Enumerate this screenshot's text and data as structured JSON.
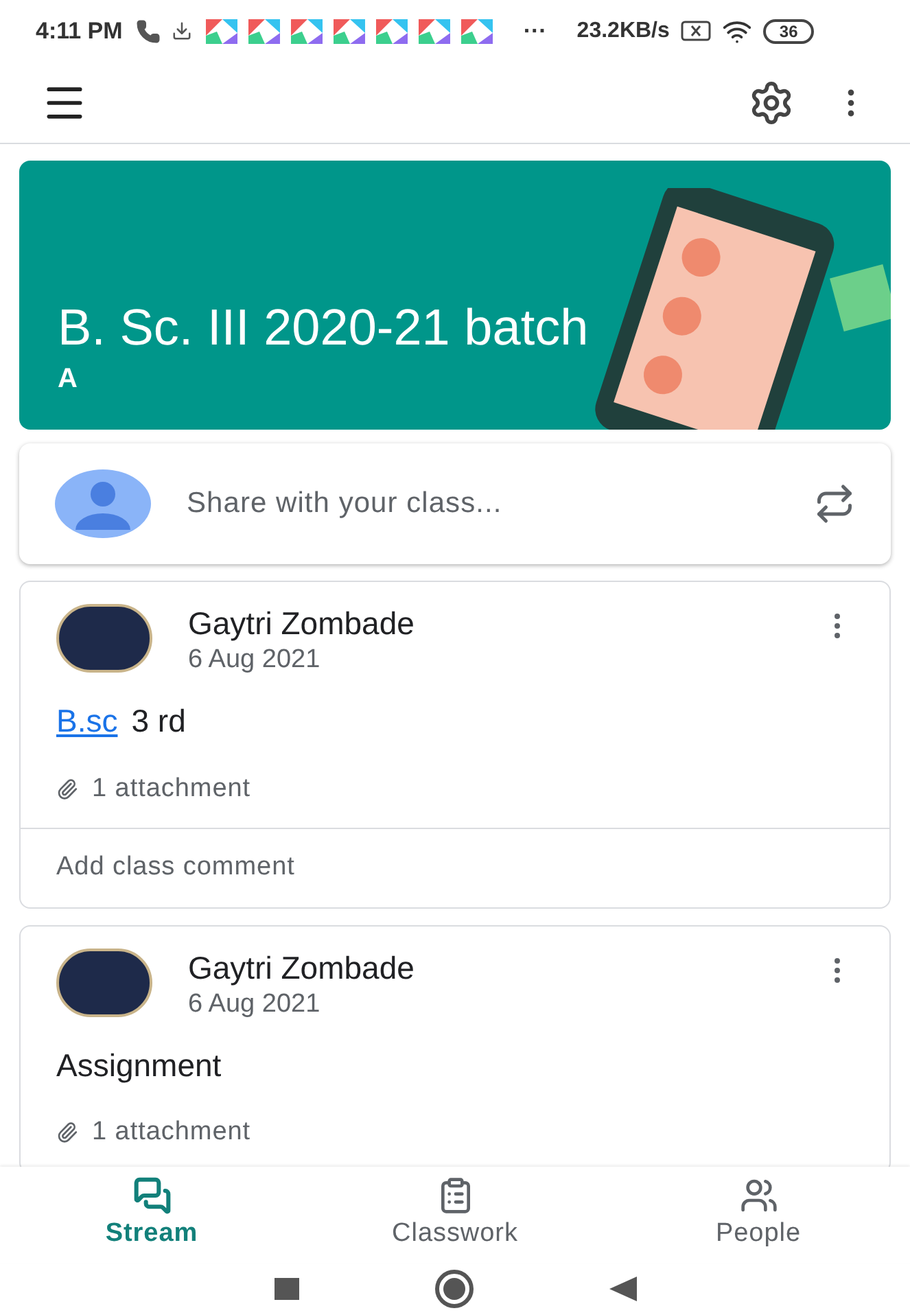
{
  "status_bar": {
    "time": "4:11 PM",
    "notifications": [
      {
        "kind": "app"
      },
      {
        "kind": "app"
      },
      {
        "kind": "app"
      },
      {
        "kind": "app"
      },
      {
        "kind": "app"
      },
      {
        "kind": "app"
      },
      {
        "kind": "app"
      }
    ],
    "more": "···",
    "speed": "23.2KB/s",
    "battery": "36"
  },
  "class": {
    "title": "B. Sc. III 2020-21 batch",
    "section": "A"
  },
  "share": {
    "placeholder": "Share with your class..."
  },
  "posts": [
    {
      "author": "Gaytri Zombade",
      "date": "6 Aug 2021",
      "body": [
        {
          "kind": "link",
          "text": "B.sc"
        },
        {
          "kind": "text",
          "text": "3 rd"
        }
      ],
      "attachments": "1 attachment",
      "comment": "Add class comment"
    },
    {
      "author": "Gaytri Zombade",
      "date": "6 Aug 2021",
      "body": [
        {
          "kind": "text",
          "text": "Assignment"
        }
      ],
      "attachments": "1 attachment"
    }
  ],
  "tabs": [
    {
      "label": "Stream",
      "selected": true
    },
    {
      "label": "Classwork",
      "selected": false
    },
    {
      "label": "People",
      "selected": false
    }
  ]
}
